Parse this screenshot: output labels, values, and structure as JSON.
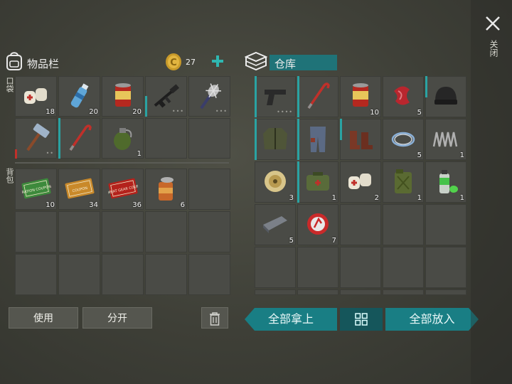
{
  "left_panel": {
    "title": "物品栏",
    "coins": "27",
    "pocket_label": "口袋",
    "backpack_label": "背包",
    "pocket_slots": [
      {
        "icon": "bandage-icon",
        "count": "18"
      },
      {
        "icon": "water-bottle-icon",
        "count": "20"
      },
      {
        "icon": "canned-food-icon",
        "count": "20"
      },
      {
        "icon": "rifle-icon",
        "count": "",
        "durability": "•••"
      },
      {
        "icon": "spiked-club-icon",
        "count": "",
        "durability": "•••"
      },
      {
        "icon": "sledgehammer-icon",
        "count": "",
        "durability": "••"
      },
      {
        "icon": "crowbar-icon",
        "count": ""
      },
      {
        "icon": "grenade-icon",
        "count": "1"
      },
      {
        "icon": "",
        "count": ""
      },
      {
        "icon": "",
        "count": ""
      }
    ],
    "backpack_slots": [
      {
        "icon": "ration-coupon-icon",
        "count": "10",
        "text": "RATION COUPON"
      },
      {
        "icon": "coupon-icon",
        "count": "34",
        "text": "COUPON"
      },
      {
        "icon": "combat-gear-coupon-icon",
        "count": "36",
        "text": "COMBAT GEAR COUPON"
      },
      {
        "icon": "open-can-icon",
        "count": "6"
      },
      {
        "icon": "",
        "count": ""
      },
      {
        "icon": "",
        "count": ""
      },
      {
        "icon": "",
        "count": ""
      },
      {
        "icon": "",
        "count": ""
      },
      {
        "icon": "",
        "count": ""
      },
      {
        "icon": "",
        "count": ""
      },
      {
        "icon": "",
        "count": ""
      },
      {
        "icon": "",
        "count": ""
      },
      {
        "icon": "",
        "count": ""
      },
      {
        "icon": "",
        "count": ""
      },
      {
        "icon": "",
        "count": ""
      }
    ]
  },
  "right_panel": {
    "title": "仓库",
    "close_label": "关闭",
    "slots": [
      {
        "icon": "pistol-icon",
        "count": "",
        "durability": "••••"
      },
      {
        "icon": "crowbar-icon",
        "count": ""
      },
      {
        "icon": "canned-food-icon",
        "count": "10"
      },
      {
        "icon": "raw-meat-icon",
        "count": "5"
      },
      {
        "icon": "beanie-icon",
        "count": ""
      },
      {
        "icon": "jacket-icon",
        "count": ""
      },
      {
        "icon": "pants-icon",
        "count": ""
      },
      {
        "icon": "boots-icon",
        "count": ""
      },
      {
        "icon": "wire-icon",
        "count": "5"
      },
      {
        "icon": "spring-icon",
        "count": "1"
      },
      {
        "icon": "spool-icon",
        "count": "3"
      },
      {
        "icon": "first-aid-bag-icon",
        "count": "1"
      },
      {
        "icon": "bandage-icon",
        "count": "2"
      },
      {
        "icon": "jerrycan-icon",
        "count": "1"
      },
      {
        "icon": "spray-can-icon",
        "count": "1"
      },
      {
        "icon": "metal-bar-icon",
        "count": "5"
      },
      {
        "icon": "bottle-cap-icon",
        "count": "7"
      },
      {
        "icon": "",
        "count": ""
      },
      {
        "icon": "",
        "count": ""
      },
      {
        "icon": "",
        "count": ""
      },
      {
        "icon": "",
        "count": ""
      },
      {
        "icon": "",
        "count": ""
      },
      {
        "icon": "",
        "count": ""
      },
      {
        "icon": "",
        "count": ""
      },
      {
        "icon": "",
        "count": ""
      },
      {
        "icon": "",
        "count": ""
      },
      {
        "icon": "",
        "count": ""
      },
      {
        "icon": "",
        "count": ""
      },
      {
        "icon": "",
        "count": ""
      },
      {
        "icon": "",
        "count": ""
      }
    ]
  },
  "buttons": {
    "use": "使用",
    "split": "分开",
    "take_all": "全部拿上",
    "put_all": "全部放入"
  },
  "colors": {
    "accent": "#197e84",
    "slot": "#4a4b46",
    "durability_red": "#c0302a"
  }
}
